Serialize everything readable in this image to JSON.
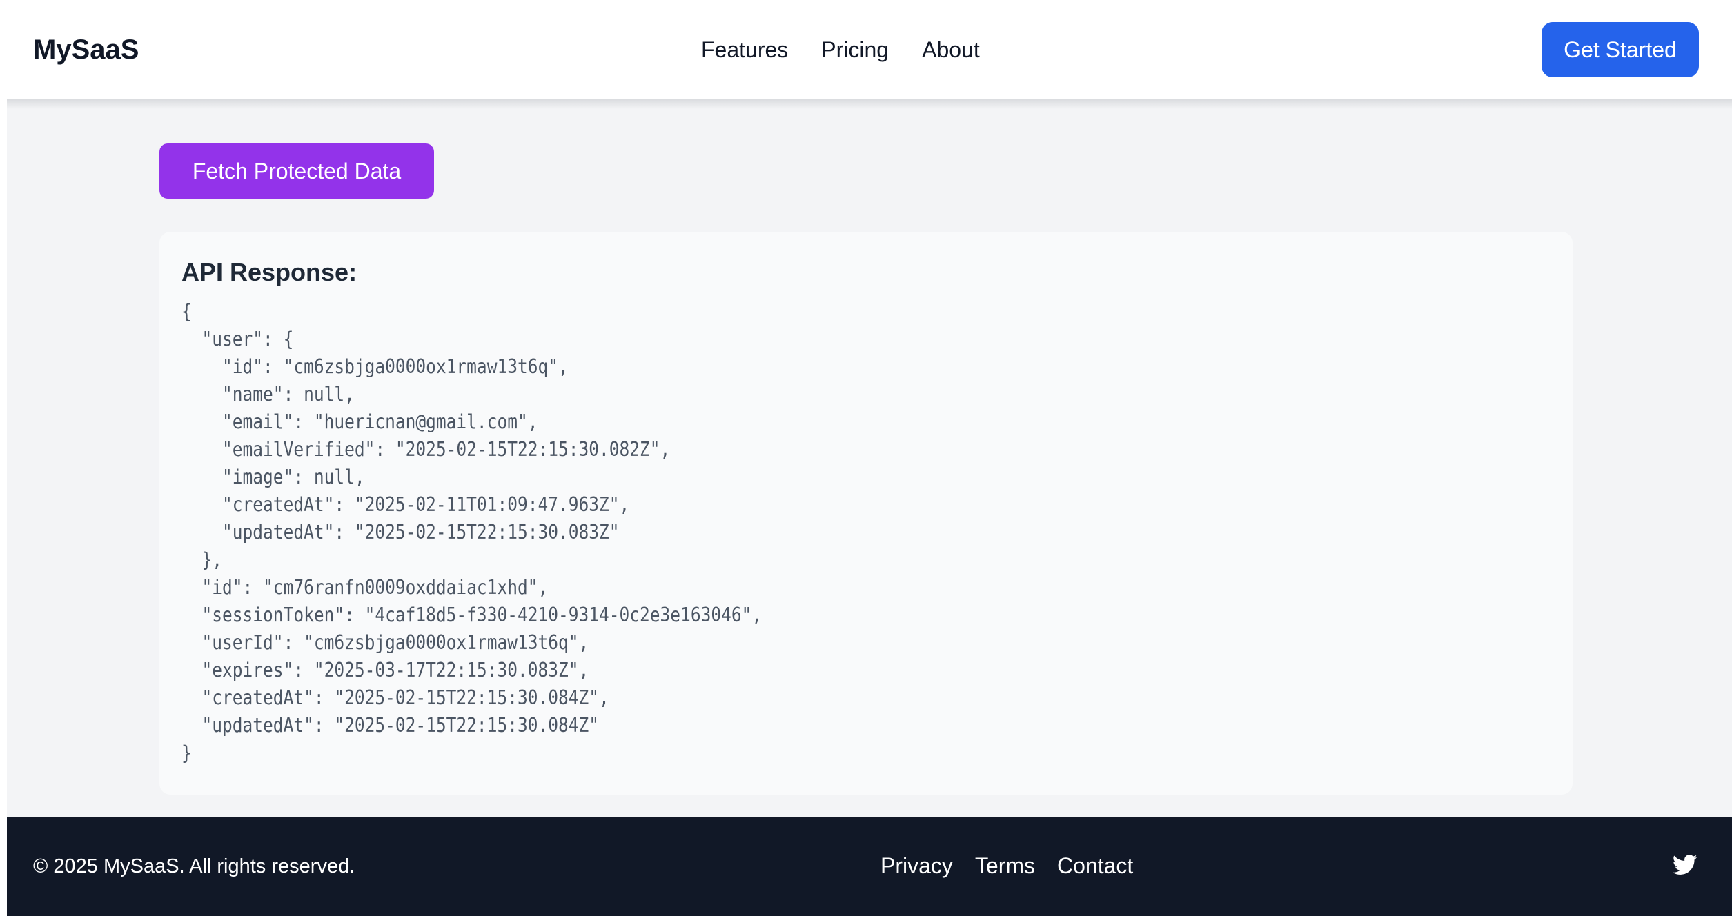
{
  "header": {
    "logo": "MySaaS",
    "nav": [
      {
        "label": "Features"
      },
      {
        "label": "Pricing"
      },
      {
        "label": "About"
      }
    ],
    "cta_label": "Get Started"
  },
  "main": {
    "fetch_button_label": "Fetch Protected Data",
    "response_title": "API Response:",
    "response_json": "{\n  \"user\": {\n    \"id\": \"cm6zsbjga0000ox1rmaw13t6q\",\n    \"name\": null,\n    \"email\": \"huericnan@gmail.com\",\n    \"emailVerified\": \"2025-02-15T22:15:30.082Z\",\n    \"image\": null,\n    \"createdAt\": \"2025-02-11T01:09:47.963Z\",\n    \"updatedAt\": \"2025-02-15T22:15:30.083Z\"\n  },\n  \"id\": \"cm76ranfn0009oxddaiac1xhd\",\n  \"sessionToken\": \"4caf18d5-f330-4210-9314-0c2e3e163046\",\n  \"userId\": \"cm6zsbjga0000ox1rmaw13t6q\",\n  \"expires\": \"2025-03-17T22:15:30.083Z\",\n  \"createdAt\": \"2025-02-15T22:15:30.084Z\",\n  \"updatedAt\": \"2025-02-15T22:15:30.084Z\"\n}"
  },
  "footer": {
    "copyright": "© 2025 MySaaS. All rights reserved.",
    "links": [
      {
        "label": "Privacy"
      },
      {
        "label": "Terms"
      },
      {
        "label": "Contact"
      }
    ],
    "social_icon": "twitter-icon"
  },
  "colors": {
    "primary": "#2563eb",
    "accent": "#9333ea",
    "footer_bg": "#111827",
    "page_bg": "#f3f4f6"
  }
}
